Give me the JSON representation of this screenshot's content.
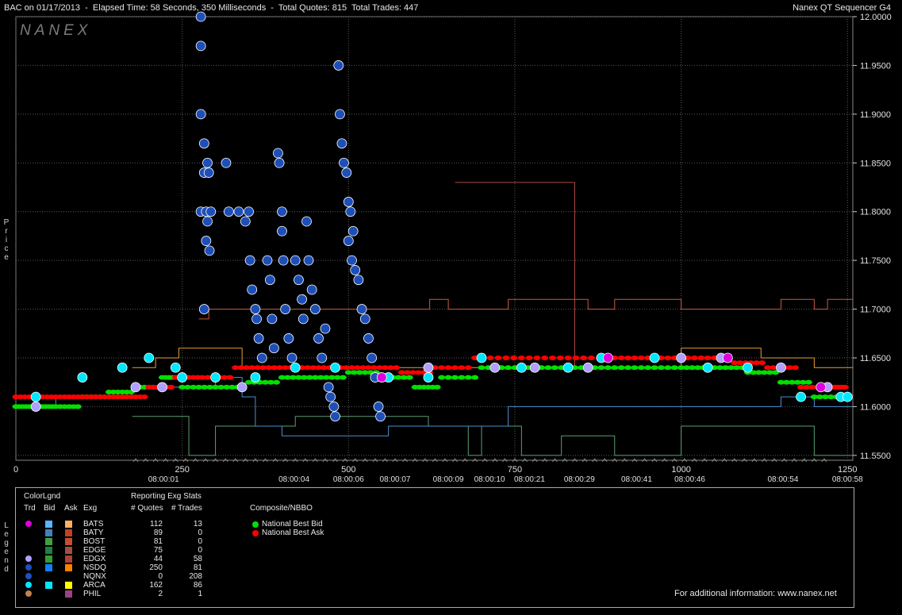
{
  "header": {
    "left_text": "BAC on 01/17/2013  -  Elapsed Time: 58 Seconds, 350 Milliseconds  -  Total Quotes: 815  Total Trades: 447",
    "right_text": "Nanex QT Sequencer G4"
  },
  "watermark": "NANEX",
  "side_labels": {
    "price": "Price",
    "legend": "Legend"
  },
  "chart_data": {
    "type": "scatter",
    "title": "BAC on 01/17/2013",
    "ylabel": "Price",
    "ylim": [
      11.545,
      12.0
    ],
    "xlim": [
      0,
      1258
    ],
    "y_ticks": [
      "12.0000",
      "11.9500",
      "11.9000",
      "11.8500",
      "11.8000",
      "11.7500",
      "11.7000",
      "11.6500",
      "11.6000",
      "11.5500"
    ],
    "x_ticks": [
      "0",
      "250",
      "500",
      "750",
      "1000",
      "1250"
    ],
    "time_labels": [
      {
        "x": 222,
        "label": "08:00:01"
      },
      {
        "x": 418,
        "label": "08:00:04"
      },
      {
        "x": 500,
        "label": "08:00:06"
      },
      {
        "x": 570,
        "label": "08:00:07"
      },
      {
        "x": 650,
        "label": "08:00:09"
      },
      {
        "x": 712,
        "label": "08:00:10"
      },
      {
        "x": 772,
        "label": "08:00:21"
      },
      {
        "x": 847,
        "label": "08:00:29"
      },
      {
        "x": 933,
        "label": "08:00:41"
      },
      {
        "x": 1013,
        "label": "08:00:46"
      },
      {
        "x": 1153,
        "label": "08:00:54"
      },
      {
        "x": 1250,
        "label": "08:00:58"
      }
    ],
    "series": [
      {
        "name": "National Best Bid",
        "color": "#00e000",
        "values": [
          [
            0,
            11.6
          ],
          [
            30,
            11.6
          ],
          [
            60,
            11.6
          ],
          [
            100,
            11.61
          ],
          [
            140,
            11.615
          ],
          [
            180,
            11.62
          ],
          [
            220,
            11.63
          ],
          [
            250,
            11.62
          ],
          [
            300,
            11.62
          ],
          [
            350,
            11.625
          ],
          [
            400,
            11.63
          ],
          [
            450,
            11.63
          ],
          [
            500,
            11.635
          ],
          [
            550,
            11.63
          ],
          [
            600,
            11.62
          ],
          [
            640,
            11.63
          ],
          [
            700,
            11.64
          ],
          [
            760,
            11.64
          ],
          [
            820,
            11.64
          ],
          [
            880,
            11.64
          ],
          [
            940,
            11.64
          ],
          [
            1000,
            11.64
          ],
          [
            1050,
            11.64
          ],
          [
            1100,
            11.635
          ],
          [
            1150,
            11.625
          ],
          [
            1200,
            11.61
          ],
          [
            1250,
            11.61
          ]
        ]
      },
      {
        "name": "National Best Ask",
        "color": "#ff0000",
        "values": [
          [
            0,
            11.61
          ],
          [
            40,
            11.61
          ],
          [
            80,
            11.61
          ],
          [
            120,
            11.61
          ],
          [
            160,
            11.61
          ],
          [
            200,
            11.62
          ],
          [
            240,
            11.63
          ],
          [
            280,
            11.63
          ],
          [
            330,
            11.64
          ],
          [
            380,
            11.64
          ],
          [
            430,
            11.64
          ],
          [
            480,
            11.64
          ],
          [
            530,
            11.64
          ],
          [
            580,
            11.635
          ],
          [
            630,
            11.64
          ],
          [
            690,
            11.65
          ],
          [
            760,
            11.65
          ],
          [
            830,
            11.65
          ],
          [
            900,
            11.65
          ],
          [
            960,
            11.65
          ],
          [
            1020,
            11.65
          ],
          [
            1080,
            11.645
          ],
          [
            1130,
            11.64
          ],
          [
            1180,
            11.62
          ],
          [
            1230,
            11.62
          ],
          [
            1250,
            11.61
          ]
        ]
      },
      {
        "name": "NSDQ",
        "color": "#1e4fb8",
        "values": [
          [
            278,
            12.0
          ],
          [
            278,
            11.97
          ],
          [
            278,
            11.9
          ],
          [
            283,
            11.87
          ],
          [
            288,
            11.85
          ],
          [
            283,
            11.84
          ],
          [
            290,
            11.84
          ],
          [
            278,
            11.8
          ],
          [
            286,
            11.8
          ],
          [
            288,
            11.79
          ],
          [
            293,
            11.8
          ],
          [
            286,
            11.77
          ],
          [
            291,
            11.76
          ],
          [
            283,
            11.7
          ],
          [
            316,
            11.85
          ],
          [
            320,
            11.8
          ],
          [
            335,
            11.8
          ],
          [
            345,
            11.79
          ],
          [
            350,
            11.8
          ],
          [
            352,
            11.75
          ],
          [
            355,
            11.72
          ],
          [
            360,
            11.7
          ],
          [
            362,
            11.69
          ],
          [
            365,
            11.67
          ],
          [
            370,
            11.65
          ],
          [
            378,
            11.75
          ],
          [
            382,
            11.73
          ],
          [
            385,
            11.69
          ],
          [
            388,
            11.66
          ],
          [
            394,
            11.86
          ],
          [
            396,
            11.85
          ],
          [
            400,
            11.8
          ],
          [
            400,
            11.78
          ],
          [
            402,
            11.75
          ],
          [
            405,
            11.7
          ],
          [
            410,
            11.67
          ],
          [
            415,
            11.65
          ],
          [
            420,
            11.75
          ],
          [
            425,
            11.73
          ],
          [
            430,
            11.71
          ],
          [
            432,
            11.69
          ],
          [
            437,
            11.79
          ],
          [
            440,
            11.75
          ],
          [
            445,
            11.72
          ],
          [
            450,
            11.7
          ],
          [
            455,
            11.67
          ],
          [
            460,
            11.65
          ],
          [
            465,
            11.68
          ],
          [
            470,
            11.62
          ],
          [
            473,
            11.61
          ],
          [
            478,
            11.6
          ],
          [
            480,
            11.59
          ],
          [
            485,
            11.95
          ],
          [
            487,
            11.9
          ],
          [
            490,
            11.87
          ],
          [
            493,
            11.85
          ],
          [
            497,
            11.84
          ],
          [
            500,
            11.81
          ],
          [
            503,
            11.8
          ],
          [
            507,
            11.78
          ],
          [
            500,
            11.77
          ],
          [
            505,
            11.75
          ],
          [
            510,
            11.74
          ],
          [
            515,
            11.73
          ],
          [
            520,
            11.7
          ],
          [
            525,
            11.69
          ],
          [
            530,
            11.67
          ],
          [
            535,
            11.65
          ],
          [
            540,
            11.63
          ],
          [
            545,
            11.6
          ],
          [
            548,
            11.59
          ]
        ]
      },
      {
        "name": "ARCA",
        "color": "#00e8ff",
        "values": [
          [
            30,
            11.61
          ],
          [
            100,
            11.63
          ],
          [
            160,
            11.64
          ],
          [
            200,
            11.65
          ],
          [
            240,
            11.64
          ],
          [
            250,
            11.63
          ],
          [
            300,
            11.63
          ],
          [
            360,
            11.63
          ],
          [
            420,
            11.64
          ],
          [
            480,
            11.64
          ],
          [
            560,
            11.63
          ],
          [
            620,
            11.63
          ],
          [
            700,
            11.65
          ],
          [
            760,
            11.64
          ],
          [
            830,
            11.64
          ],
          [
            880,
            11.65
          ],
          [
            960,
            11.65
          ],
          [
            1040,
            11.64
          ],
          [
            1100,
            11.64
          ],
          [
            1180,
            11.61
          ],
          [
            1240,
            11.61
          ],
          [
            1250,
            11.61
          ]
        ]
      },
      {
        "name": "EDGX",
        "color": "#b0a0ff",
        "values": [
          [
            30,
            11.6
          ],
          [
            180,
            11.62
          ],
          [
            220,
            11.62
          ],
          [
            340,
            11.62
          ],
          [
            620,
            11.64
          ],
          [
            720,
            11.64
          ],
          [
            780,
            11.64
          ],
          [
            860,
            11.64
          ],
          [
            1000,
            11.65
          ],
          [
            1060,
            11.65
          ],
          [
            1150,
            11.64
          ],
          [
            1220,
            11.62
          ]
        ]
      },
      {
        "name": "BATS",
        "color": "#e000e0",
        "values": [
          [
            550,
            11.63
          ],
          [
            890,
            11.65
          ],
          [
            1070,
            11.65
          ],
          [
            1210,
            11.62
          ]
        ]
      }
    ],
    "ask_line_orange": [
      [
        175,
        11.64
      ],
      [
        210,
        11.65
      ],
      [
        245,
        11.66
      ],
      [
        290,
        11.66
      ],
      [
        340,
        11.64
      ],
      [
        400,
        11.64
      ],
      [
        470,
        11.64
      ],
      [
        530,
        11.64
      ],
      [
        560,
        11.64
      ],
      [
        620,
        11.64
      ],
      [
        700,
        11.64
      ],
      [
        760,
        11.64
      ],
      [
        900,
        11.64
      ],
      [
        1000,
        11.66
      ],
      [
        1060,
        11.66
      ],
      [
        1120,
        11.65
      ],
      [
        1200,
        11.64
      ],
      [
        1258,
        11.64
      ]
    ],
    "brown_line": [
      [
        275,
        11.69
      ],
      [
        290,
        11.7
      ],
      [
        330,
        11.7
      ],
      [
        380,
        11.7
      ],
      [
        470,
        11.7
      ],
      [
        520,
        11.7
      ],
      [
        620,
        11.7
      ],
      [
        622,
        11.71
      ],
      [
        650,
        11.7
      ],
      [
        700,
        11.7
      ],
      [
        740,
        11.71
      ],
      [
        800,
        11.71
      ],
      [
        860,
        11.7
      ],
      [
        900,
        11.71
      ],
      [
        1000,
        11.7
      ],
      [
        1060,
        11.7
      ],
      [
        1150,
        11.71
      ],
      [
        1200,
        11.7
      ],
      [
        1220,
        11.71
      ],
      [
        1258,
        11.71
      ]
    ],
    "upper_brown": [
      [
        660,
        11.83
      ],
      [
        840,
        11.83
      ],
      [
        840,
        11.64
      ]
    ],
    "green_step": [
      [
        175,
        11.59
      ],
      [
        260,
        11.59
      ],
      [
        260,
        11.55
      ],
      [
        300,
        11.55
      ],
      [
        300,
        11.58
      ],
      [
        360,
        11.58
      ],
      [
        420,
        11.59
      ],
      [
        480,
        11.59
      ],
      [
        560,
        11.59
      ],
      [
        620,
        11.58
      ],
      [
        680,
        11.55
      ],
      [
        700,
        11.58
      ],
      [
        760,
        11.55
      ],
      [
        820,
        11.57
      ],
      [
        900,
        11.55
      ],
      [
        1000,
        11.58
      ],
      [
        1060,
        11.58
      ],
      [
        1160,
        11.58
      ],
      [
        1200,
        11.55
      ],
      [
        1258,
        11.55
      ]
    ],
    "blue_line": [
      [
        0,
        11.6
      ],
      [
        30,
        11.6
      ],
      [
        60,
        11.61
      ],
      [
        140,
        11.61
      ],
      [
        175,
        11.62
      ],
      [
        260,
        11.62
      ],
      [
        300,
        11.63
      ],
      [
        340,
        11.61
      ],
      [
        360,
        11.58
      ],
      [
        400,
        11.57
      ],
      [
        480,
        11.57
      ],
      [
        560,
        11.58
      ],
      [
        620,
        11.58
      ],
      [
        700,
        11.58
      ],
      [
        740,
        11.6
      ],
      [
        800,
        11.6
      ],
      [
        900,
        11.6
      ],
      [
        1000,
        11.6
      ],
      [
        1100,
        11.6
      ],
      [
        1150,
        11.61
      ],
      [
        1200,
        11.6
      ],
      [
        1258,
        11.6
      ]
    ],
    "grid": true
  },
  "legend": {
    "color_legend_title": "ColorLgnd",
    "stats_title": "Reporting Exg Stats",
    "composite_title": "Composite/NBBO",
    "col_trd": "Trd",
    "col_bid": "Bid",
    "col_ask": "Ask",
    "col_exg": "Exg",
    "col_quotes": "# Quotes",
    "col_trades": "# Trades",
    "nbbo_bid_label": "National Best Bid",
    "nbbo_ask_label": "National Best Ask",
    "footer": "For additional information: www.nanex.net",
    "exchanges": [
      {
        "name": "BATS",
        "quotes": "112",
        "trades": "13",
        "trd": "#e000e0",
        "bid": "#5ab4ff",
        "ask": "#ffb060"
      },
      {
        "name": "BATY",
        "quotes": "89",
        "trades": "0",
        "trd": "",
        "bid": "#4080c0",
        "ask": "#c04020"
      },
      {
        "name": "BOST",
        "quotes": "81",
        "trades": "0",
        "trd": "",
        "bid": "#40a040",
        "ask": "#c05030"
      },
      {
        "name": "EDGE",
        "quotes": "75",
        "trades": "0",
        "trd": "",
        "bid": "#208040",
        "ask": "#a05040"
      },
      {
        "name": "EDGX",
        "quotes": "44",
        "trades": "58",
        "trd": "#b0a0ff",
        "bid": "#30a030",
        "ask": "#b04030"
      },
      {
        "name": "NSDQ",
        "quotes": "250",
        "trades": "81",
        "trd": "#1e4fb8",
        "bid": "#1080ff",
        "ask": "#ff8000"
      },
      {
        "name": "NQNX",
        "quotes": "0",
        "trades": "208",
        "trd": "#2050c0",
        "bid": "",
        "ask": ""
      },
      {
        "name": "ARCA",
        "quotes": "162",
        "trades": "86",
        "trd": "#00e8ff",
        "bid": "#00e8ff",
        "ask": "#ffff00"
      },
      {
        "name": "PHIL",
        "quotes": "2",
        "trades": "1",
        "trd": "#c08050",
        "bid": "",
        "ask": "#a04080"
      }
    ]
  }
}
